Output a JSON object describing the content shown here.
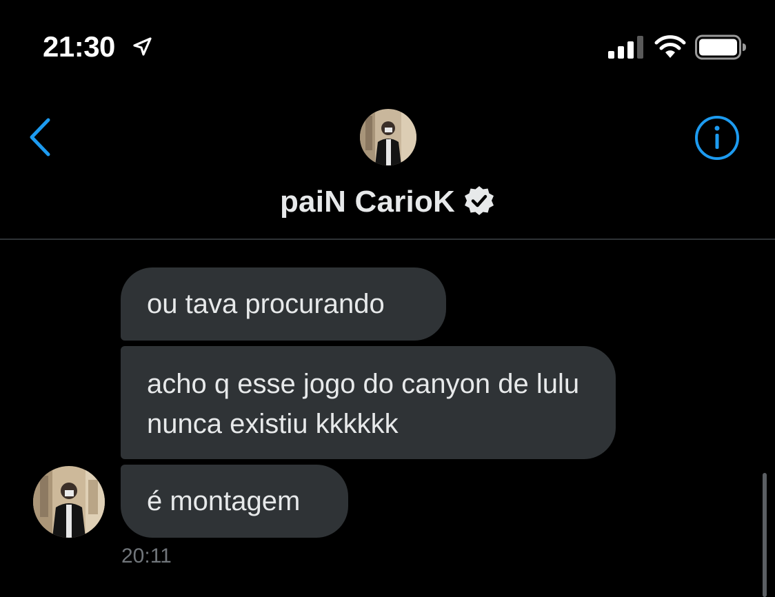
{
  "status_bar": {
    "time": "21:30",
    "icons": [
      "location-arrow-icon",
      "cellular-signal-icon",
      "wifi-icon",
      "battery-icon"
    ]
  },
  "header": {
    "back_icon": "chevron-left-icon",
    "contact_name": "paiN CarioK",
    "verified_icon": "verified-badge-icon",
    "info_icon": "info-circle-icon"
  },
  "messages": [
    {
      "text": "ou tava procurando"
    },
    {
      "text": "acho q esse jogo do canyon de lulu nunca existiu kkkkkk"
    },
    {
      "text": "é montagem"
    }
  ],
  "timestamp": "20:11",
  "colors": {
    "background": "#000000",
    "accent": "#1d9bf0",
    "bubble": "#2f3336",
    "text": "#e7e9ea",
    "muted": "#71767b",
    "divider": "#2f3336"
  }
}
